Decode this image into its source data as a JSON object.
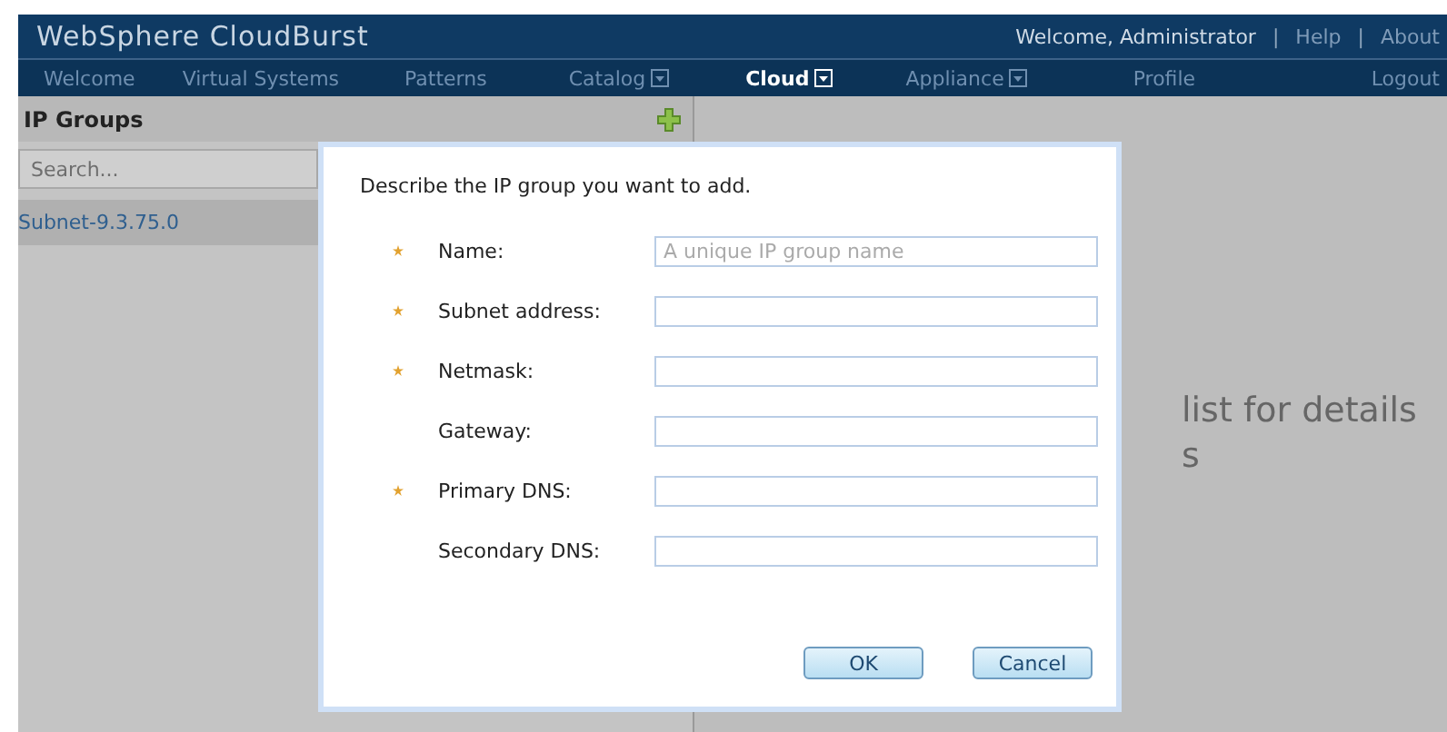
{
  "header": {
    "title": "WebSphere CloudBurst",
    "welcome": "Welcome, Administrator",
    "separator_1": "|",
    "help": "Help",
    "separator_2": "|",
    "about": "About"
  },
  "nav": [
    {
      "label": "Welcome",
      "selected": false,
      "has_menu": false
    },
    {
      "label": "Virtual Systems",
      "selected": false,
      "has_menu": false
    },
    {
      "label": "Patterns",
      "selected": false,
      "has_menu": false
    },
    {
      "label": "Catalog",
      "selected": false,
      "has_menu": true
    },
    {
      "label": "Cloud",
      "selected": true,
      "has_menu": true
    },
    {
      "label": "Appliance",
      "selected": false,
      "has_menu": true
    },
    {
      "label": "Profile",
      "selected": false,
      "has_menu": false
    },
    {
      "label": "Logout",
      "selected": false,
      "has_menu": false
    }
  ],
  "sidebar": {
    "title": "IP Groups",
    "search": {
      "placeholder": "Search..."
    },
    "items": [
      {
        "label": "Subnet-9.3.75.0",
        "selected": true
      }
    ]
  },
  "main": {
    "hint_lines": [
      "list for details",
      "s"
    ]
  },
  "dialog": {
    "intro": "Describe the IP group you want to add.",
    "fields": [
      {
        "label": "Name:",
        "required": true,
        "placeholder": "A unique IP group name"
      },
      {
        "label": "Subnet address:",
        "required": true
      },
      {
        "label": "Netmask:",
        "required": true
      },
      {
        "label": "Gateway:",
        "required": false
      },
      {
        "label": "Primary DNS:",
        "required": true
      },
      {
        "label": "Secondary DNS:",
        "required": false
      }
    ],
    "buttons": [
      "OK",
      "Cancel"
    ]
  }
}
